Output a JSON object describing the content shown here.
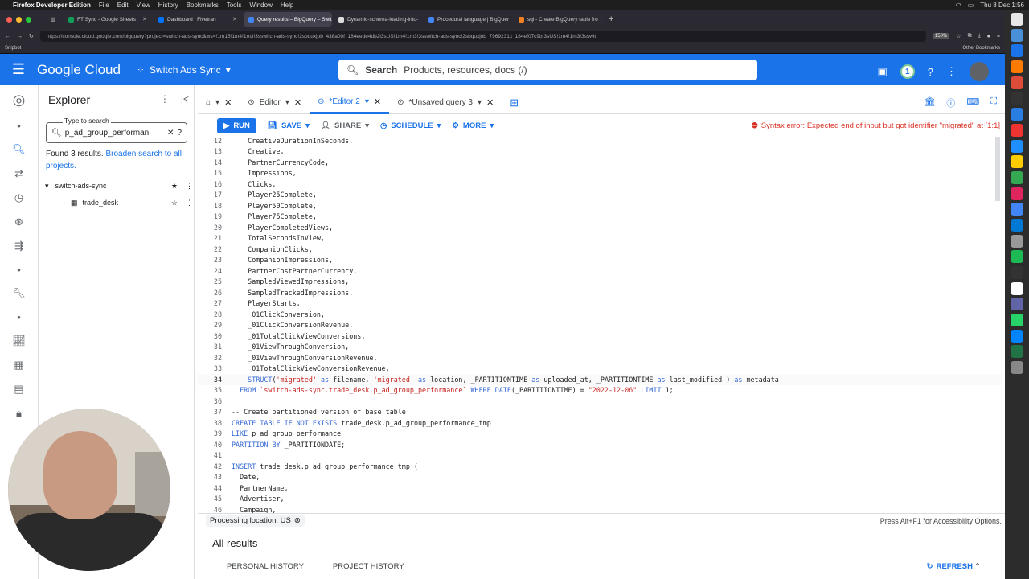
{
  "macbar": {
    "app": "Firefox Developer Edition",
    "menus": [
      "File",
      "Edit",
      "View",
      "History",
      "Bookmarks",
      "Tools",
      "Window",
      "Help"
    ],
    "clock": "Thu 8 Dec  1:56"
  },
  "browser": {
    "tabs": [
      {
        "label": "FT Sync - Google Sheets",
        "active": false
      },
      {
        "label": "Dashboard | Fivetran",
        "active": false
      },
      {
        "label": "Query results – BigQuery – Swit",
        "active": true
      },
      {
        "label": "Dynamic-schema-loading-into-",
        "active": false
      },
      {
        "label": "Procedural language | BigQuer",
        "active": false
      },
      {
        "label": "sql - Create BigQuery table fro",
        "active": false
      }
    ],
    "url": "https://console.cloud.google.com/bigquery?project=switch-ads-sync&ws=!1m15!1m4!1m3!3sswitch-ads-sync!2sbquxjob_438a00f_184eede4db2l3sUS!1m4!1m3!3sswitch-ads-sync!2sbquxjob_7969231c_184ef07c9b!3sUS!1m4!1m3!3sswit",
    "zoom": "150%",
    "bookmark_left": "Snipbot",
    "bookmark_right": "Other Bookmarks"
  },
  "header": {
    "logo": "Google Cloud",
    "project": "Switch Ads Sync",
    "search_label": "Search",
    "search_placeholder": "Products, resources, docs (/)",
    "notif_count": "1"
  },
  "explorer": {
    "title": "Explorer",
    "search_label": "Type to search",
    "search_value": "p_ad_group_performan",
    "found_text": "Found 3 results.",
    "broaden_link": "Broaden search to all projects.",
    "project": "switch-ads-sync",
    "dataset": "trade_desk"
  },
  "editor_tabs": [
    {
      "label": "Editor",
      "active": false
    },
    {
      "label": "*Editor 2",
      "active": true
    },
    {
      "label": "*Unsaved query 3",
      "active": false
    }
  ],
  "toolbar": {
    "run": "RUN",
    "save": "SAVE",
    "share": "SHARE",
    "schedule": "SCHEDULE",
    "more": "MORE",
    "error": "Syntax error: Expected end of input but got identifier \"migrated\" at [1:1]"
  },
  "code": [
    {
      "n": "12",
      "t": "    CreativeDurationInSeconds,"
    },
    {
      "n": "13",
      "t": "    Creative,"
    },
    {
      "n": "14",
      "t": "    PartnerCurrencyCode,"
    },
    {
      "n": "15",
      "t": "    Impressions,"
    },
    {
      "n": "16",
      "t": "    Clicks,"
    },
    {
      "n": "17",
      "t": "    Player25Complete,"
    },
    {
      "n": "18",
      "t": "    Player50Complete,"
    },
    {
      "n": "19",
      "t": "    Player75Complete,"
    },
    {
      "n": "20",
      "t": "    PlayerCompletedViews,"
    },
    {
      "n": "21",
      "t": "    TotalSecondsInView,"
    },
    {
      "n": "22",
      "t": "    CompanionClicks,"
    },
    {
      "n": "23",
      "t": "    CompanionImpressions,"
    },
    {
      "n": "24",
      "t": "    PartnerCostPartnerCurrency,"
    },
    {
      "n": "25",
      "t": "    SampledViewedImpressions,"
    },
    {
      "n": "26",
      "t": "    SampledTrackedImpressions,"
    },
    {
      "n": "27",
      "t": "    PlayerStarts,"
    },
    {
      "n": "28",
      "t": "    _01ClickConversion,"
    },
    {
      "n": "29",
      "t": "    _01ClickConversionRevenue,"
    },
    {
      "n": "30",
      "t": "    _01TotalClickViewConversions,"
    },
    {
      "n": "31",
      "t": "    _01ViewThroughConversion,"
    },
    {
      "n": "32",
      "t": "    _01ViewThroughConversionRevenue,"
    },
    {
      "n": "33",
      "t": "    _01TotalClickViewConversionRevenue,"
    },
    {
      "n": "34",
      "t": "    STRUCT('migrated' as filename, 'migrated' as location, _PARTITIONTIME as uploaded_at, _PARTITIONTIME as last_modified ) as metadata"
    },
    {
      "n": "35",
      "t": "  FROM `switch-ads-sync.trade_desk.p_ad_group_performance` WHERE DATE(_PARTITIONTIME) = \"2022-12-06\" LIMIT 1;"
    },
    {
      "n": "36",
      "t": ""
    },
    {
      "n": "37",
      "t": "-- Create partitioned version of base table"
    },
    {
      "n": "38",
      "t": "CREATE TABLE IF NOT EXISTS trade_desk.p_ad_group_performance_tmp"
    },
    {
      "n": "39",
      "t": "LIKE p_ad_group_performance"
    },
    {
      "n": "40",
      "t": "PARTITION BY _PARTITIONDATE;"
    },
    {
      "n": "41",
      "t": ""
    },
    {
      "n": "42",
      "t": "INSERT trade_desk.p_ad_group_performance_tmp ("
    },
    {
      "n": "43",
      "t": "  Date,"
    },
    {
      "n": "44",
      "t": "  PartnerName,"
    },
    {
      "n": "45",
      "t": "  Advertiser,"
    },
    {
      "n": "46",
      "t": "  Campaign,"
    }
  ],
  "status": {
    "location": "Processing location: US",
    "hint": "Press Alt+F1 for Accessibility Options."
  },
  "results": {
    "title": "All results",
    "tabs": [
      "PERSONAL HISTORY",
      "PROJECT HISTORY"
    ],
    "refresh": "REFRESH"
  }
}
